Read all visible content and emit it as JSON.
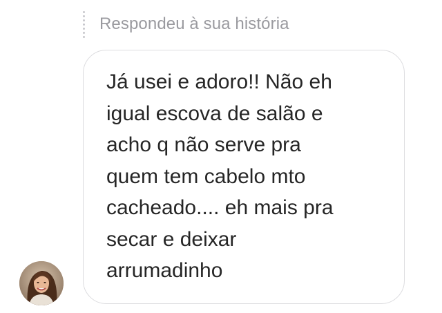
{
  "reply": {
    "label": "Respondeu à sua história"
  },
  "message": {
    "text": "Já usei e adoro!! Não eh\nigual escova de salão e\nacho q não serve pra\nquem tem cabelo mto\ncacheado.... eh mais pra\nsecar e deixar\narrumadinho"
  },
  "colors": {
    "background": "#ffffff",
    "bubble_border": "#dcdcdf",
    "text": "#262626",
    "meta_text": "#9a9a9f"
  },
  "icons": {
    "reply_indicator": "dotted-vertical-line-icon"
  }
}
